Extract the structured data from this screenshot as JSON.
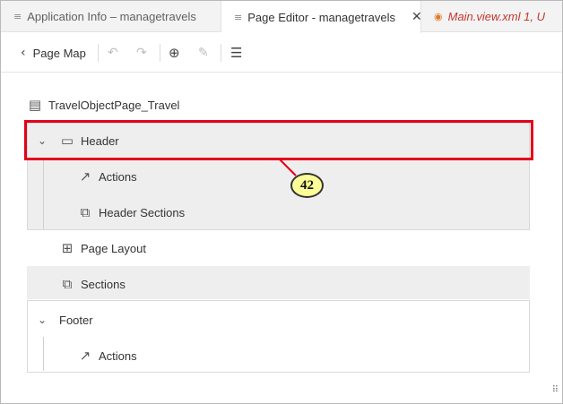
{
  "tabs": [
    {
      "label": "Application Info – managetravels",
      "icon": "document-lines-icon"
    },
    {
      "label": "Page Editor - managetravels",
      "icon": "document-lines-icon",
      "active": true
    },
    {
      "label": "Main.view.xml 1, U",
      "icon": "rss-icon",
      "color": "#c6362c"
    }
  ],
  "toolbar": {
    "back_label": "Page Map",
    "back_glyph": "‹",
    "undo_glyph": "↶",
    "redo_glyph": "↷",
    "globe_glyph": "⊕",
    "brush_glyph": "✎",
    "list_glyph": "☰"
  },
  "tree": {
    "root": {
      "label": "TravelObjectPage_Travel",
      "icon": "object-page-icon"
    },
    "header": {
      "label": "Header",
      "icon": "header-layout-icon",
      "chevron": "⌄",
      "children": [
        {
          "label": "Actions",
          "icon": "open-external-icon"
        },
        {
          "label": "Header Sections",
          "icon": "puzzle-icon"
        }
      ]
    },
    "page_layout": {
      "label": "Page Layout",
      "icon": "layout-grid-icon"
    },
    "sections": {
      "label": "Sections",
      "icon": "puzzle-icon"
    },
    "footer": {
      "label": "Footer",
      "chevron": "⌄",
      "children": [
        {
          "label": "Actions",
          "icon": "open-external-icon"
        }
      ]
    }
  },
  "callout": {
    "number": "42",
    "color": "#e3001b",
    "badge_color": "#ffff99"
  },
  "colors": {
    "selected_bg": "#eeeeee",
    "accent_red": "#e3001b"
  }
}
